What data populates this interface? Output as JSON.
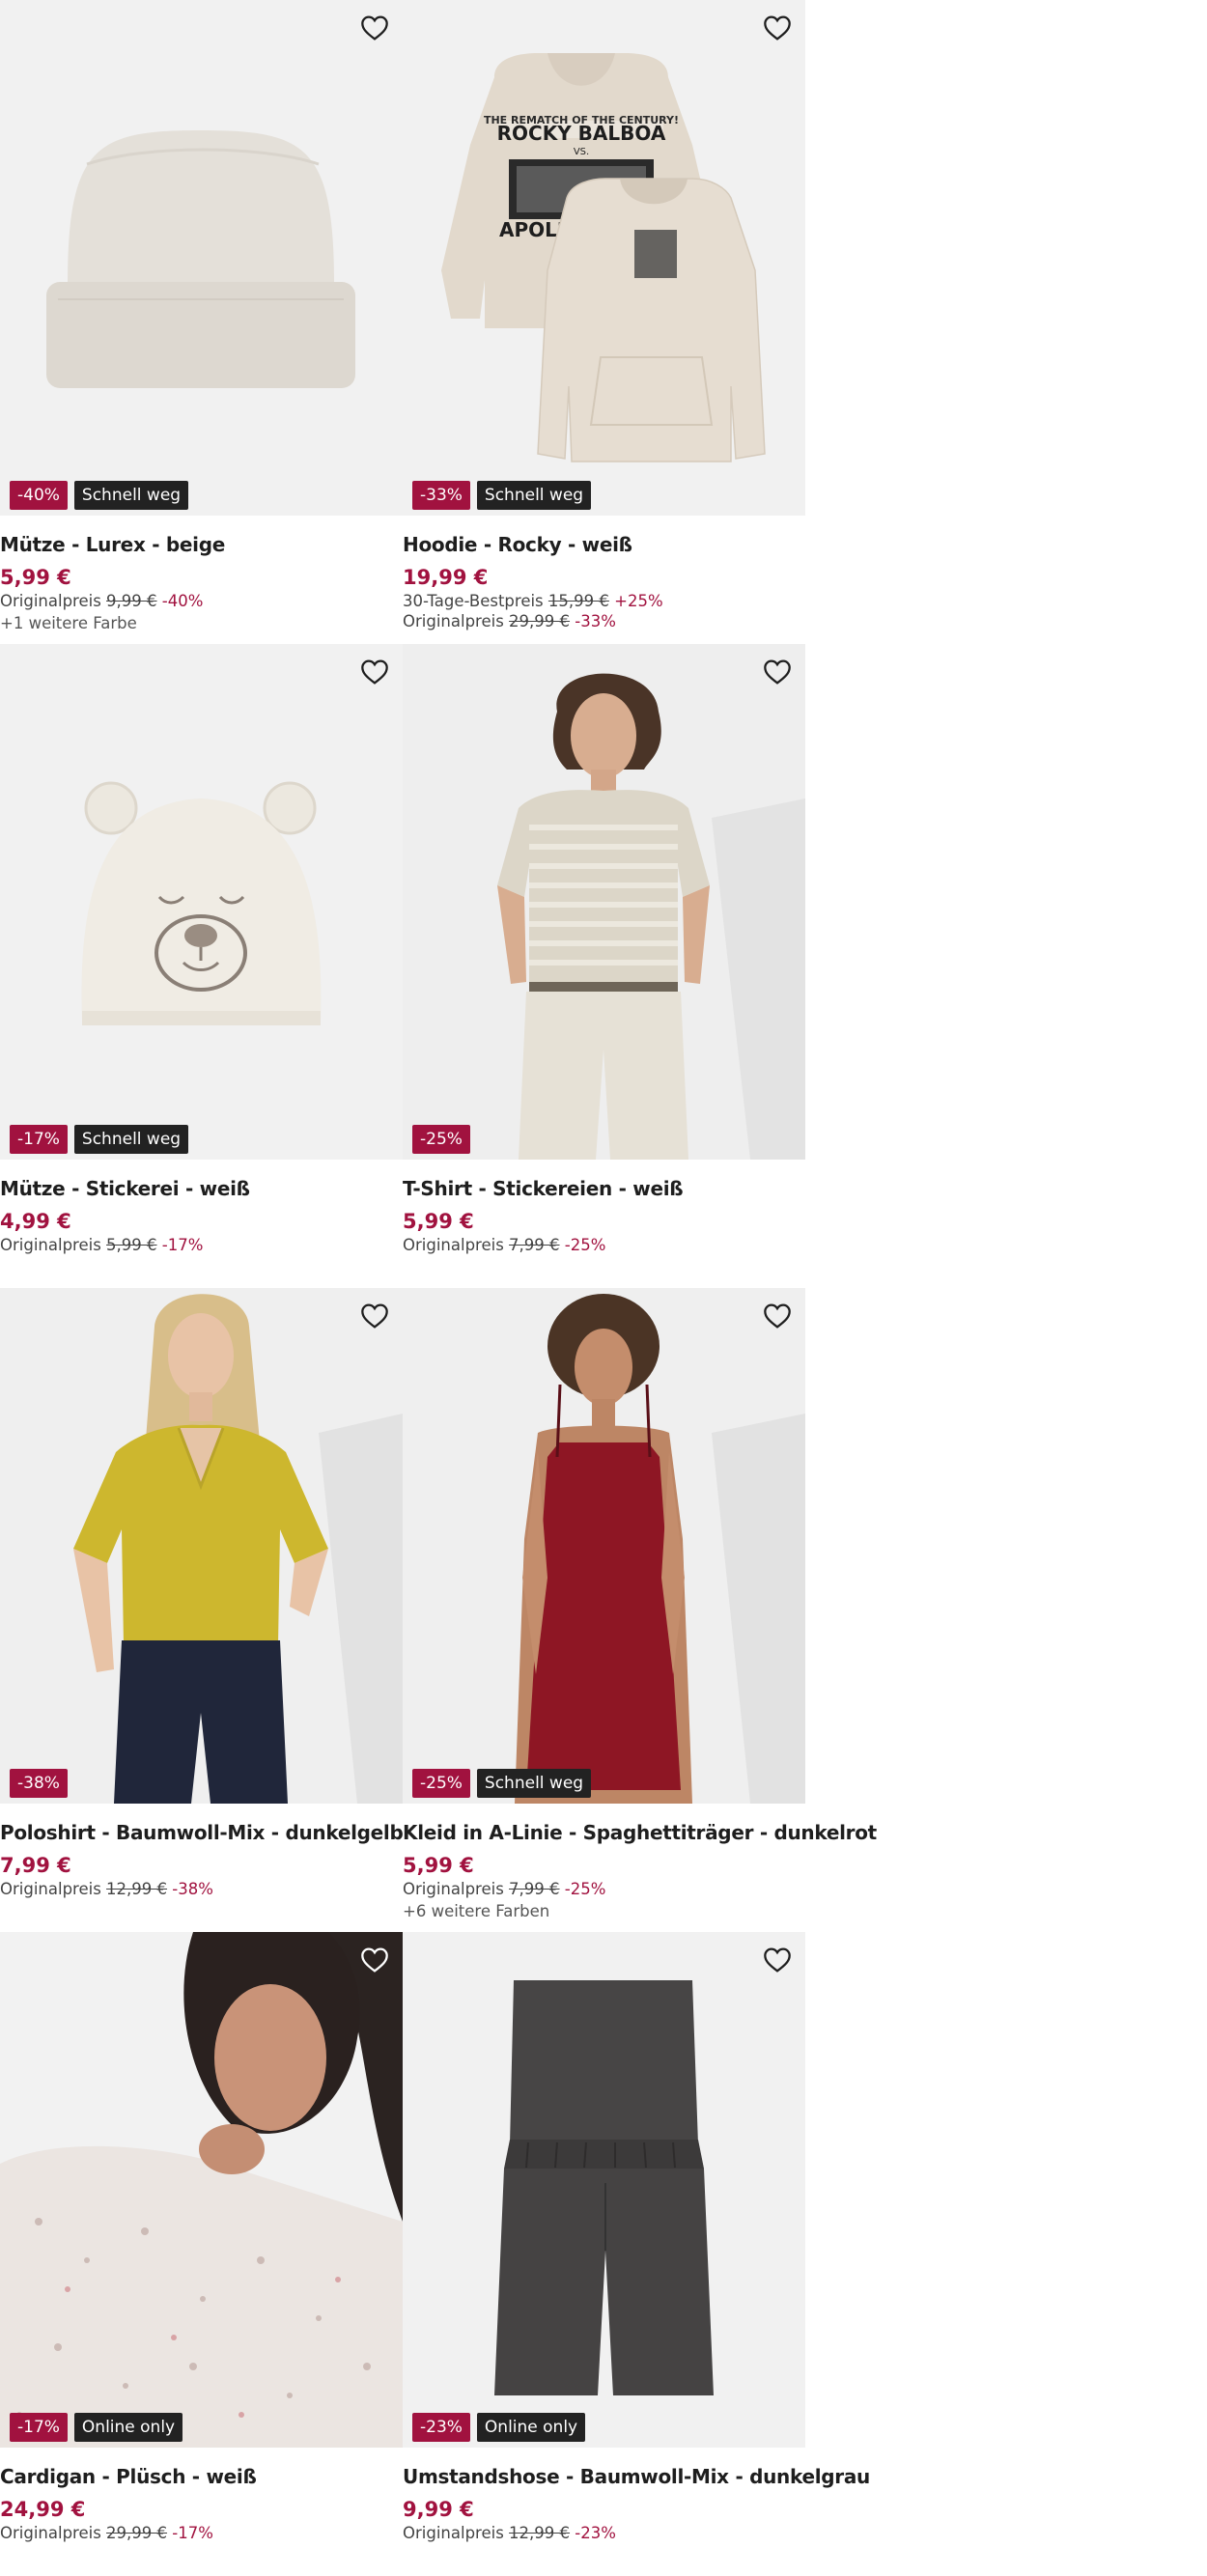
{
  "products": [
    {
      "title": "Mütze - Lurex - beige",
      "price": "5,99 €",
      "badges": {
        "discount": "-40%",
        "flag": "Schnell weg"
      },
      "lines": [
        {
          "label": "Originalpreis",
          "old": "9,99 €",
          "pct": "-40%"
        }
      ],
      "colors": "+1 weitere Farbe",
      "icon": "beanie-image"
    },
    {
      "title": "Hoodie - Rocky - weiß",
      "price": "19,99 €",
      "badges": {
        "discount": "-33%",
        "flag": "Schnell weg"
      },
      "lines": [
        {
          "label": "30-Tage-Bestpreis",
          "old": "15,99 €",
          "pct": "+25%"
        },
        {
          "label": "Originalpreis",
          "old": "29,99 €",
          "pct": "-33%"
        }
      ],
      "colors": "",
      "icon": "hoodie-image",
      "print_text": [
        "THE REMATCH OF THE CENTURY!",
        "ROCKY BALBOA",
        "VS.",
        "APOLLO CREED"
      ]
    },
    {
      "title": "Mütze - Stickerei - weiß",
      "price": "4,99 €",
      "badges": {
        "discount": "-17%",
        "flag": "Schnell weg"
      },
      "lines": [
        {
          "label": "Originalpreis",
          "old": "5,99 €",
          "pct": "-17%"
        }
      ],
      "colors": "",
      "icon": "bear-beanie-image"
    },
    {
      "title": "T-Shirt - Stickereien - weiß",
      "price": "5,99 €",
      "badges": {
        "discount": "-25%",
        "flag": ""
      },
      "lines": [
        {
          "label": "Originalpreis",
          "old": "7,99 €",
          "pct": "-25%"
        }
      ],
      "colors": "",
      "icon": "striped-tshirt-model-image"
    },
    {
      "title": "Poloshirt - Baumwoll-Mix - dunkelgelb",
      "price": "7,99 €",
      "badges": {
        "discount": "-38%",
        "flag": ""
      },
      "lines": [
        {
          "label": "Originalpreis",
          "old": "12,99 €",
          "pct": "-38%"
        }
      ],
      "colors": "",
      "icon": "polo-model-image"
    },
    {
      "title": "Kleid in A-Linie - Spaghettiträger - dunkelrot",
      "price": "5,99 €",
      "badges": {
        "discount": "-25%",
        "flag": "Schnell weg"
      },
      "lines": [
        {
          "label": "Originalpreis",
          "old": "7,99 €",
          "pct": "-25%"
        }
      ],
      "colors": "+6 weitere Farben",
      "icon": "dress-model-image"
    },
    {
      "title": "Cardigan - Plüsch - weiß",
      "price": "24,99 €",
      "badges": {
        "discount": "-17%",
        "flag": "Online only"
      },
      "lines": [
        {
          "label": "Originalpreis",
          "old": "29,99 €",
          "pct": "-17%"
        }
      ],
      "colors": "",
      "icon": "cardigan-model-image"
    },
    {
      "title": "Umstandshose - Baumwoll-Mix - dunkelgrau",
      "price": "9,99 €",
      "badges": {
        "discount": "-23%",
        "flag": "Online only"
      },
      "lines": [
        {
          "label": "Originalpreis",
          "old": "12,99 €",
          "pct": "-23%"
        }
      ],
      "colors": "",
      "icon": "maternity-shorts-image"
    }
  ],
  "wishlist_icon": "heart-outline-icon",
  "colors": {
    "sale": "#a1123f",
    "flag_bg": "#222222",
    "image_bg": "#f2f2f2"
  }
}
